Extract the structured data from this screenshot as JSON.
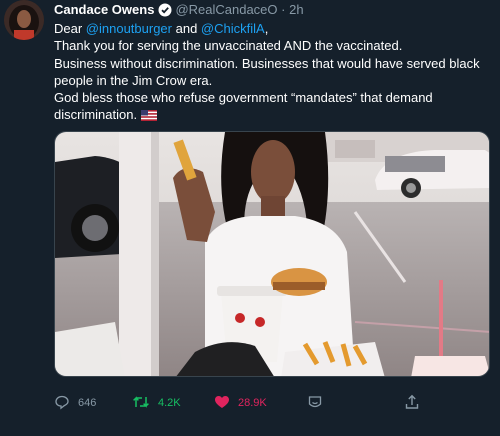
{
  "tweet": {
    "author_name": "Candace Owens",
    "handle": "@RealCandaceO",
    "separator": "·",
    "time": "2h",
    "body": {
      "greeting": "Dear ",
      "mention1": "@innoutburger",
      "and_word": " and ",
      "mention2": "@ChickfilA",
      "greeting_end": ",",
      "line2": "Thank you for serving the unvaccinated AND the vaccinated.",
      "line3": "Business without discrimination. Businesses that would have served black",
      "line4": "people in the Jim Crow era.",
      "line5": "God bless those who refuse government “mandates” that demand",
      "line6": "discrimination."
    },
    "flag_icon": "us-flag-emoji",
    "actions": {
      "reply_count": "646",
      "retweet_count": "4.2K",
      "like_count": "28.9K"
    }
  },
  "colors": {
    "background": "#15202b",
    "link": "#1da1f2",
    "muted": "#8899a6",
    "retweet": "#17bf63",
    "like": "#e0245e"
  }
}
